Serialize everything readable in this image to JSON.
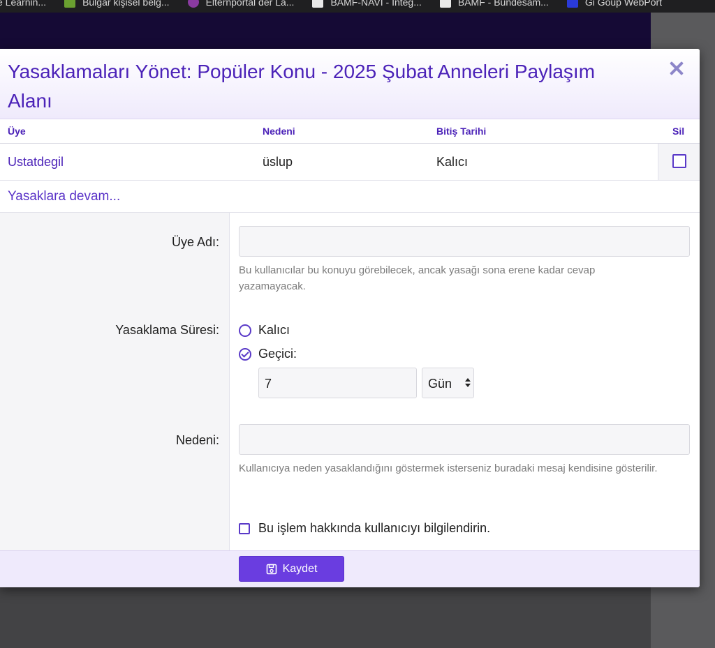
{
  "bookmarks": [
    {
      "label": "e Learnin...",
      "icon": "page-icon",
      "color": "#6a6a6a"
    },
    {
      "label": "Bulgar kişisel belg...",
      "icon": "flag-icon",
      "color": "#6aa030"
    },
    {
      "label": "Elternportal der La...",
      "icon": "star-icon",
      "color": "#8a3aa0"
    },
    {
      "label": "BAMF-NAVI - Integ...",
      "icon": "eagle-icon",
      "color": "#e8e8e8"
    },
    {
      "label": "BAMF - Bundesam...",
      "icon": "eagle-icon",
      "color": "#e8e8e8"
    },
    {
      "label": "Gi Goup WebPort",
      "icon": "logo-icon",
      "color": "#2a3ad8"
    }
  ],
  "modal": {
    "title": "Yasaklamaları Yönet: Popüler Konu - 2025 Şubat Anneleri Paylaşım Alanı",
    "close_icon": "close-icon"
  },
  "table": {
    "headers": {
      "user": "Üye",
      "reason": "Nedeni",
      "end_date": "Bitiş Tarihi",
      "delete": "Sil"
    },
    "rows": [
      {
        "user": "Ustatdegil",
        "reason": "üslup",
        "end_date": "Kalıcı",
        "delete_checked": false
      }
    ],
    "more_link": "Yasaklara devam..."
  },
  "form": {
    "username_label": "Üye Adı:",
    "username_value": "",
    "username_hint": "Bu kullanıcılar bu konuyu görebilecek, ancak yasağı sona erene kadar cevap yazamayacak.",
    "duration_label": "Yasaklama Süresi:",
    "permanent_label": "Kalıcı",
    "temporary_label": "Geçici:",
    "selected_duration": "temporary",
    "duration_value": "7",
    "duration_unit": "Gün",
    "reason_label": "Nedeni:",
    "reason_value": "",
    "reason_hint": "Kullanıcıya neden yasaklandığını göstermek isterseniz buradaki mesaj kendisine gösterilir.",
    "notify_label": "Bu işlem hakkında kullanıcıyı bilgilendirin.",
    "notify_checked": false
  },
  "footer": {
    "save_label": "Kaydet",
    "save_icon": "floppy-disk-icon"
  },
  "colors": {
    "accent": "#4b22b8",
    "button": "#6a3de0",
    "header_bg": "#efeafc"
  }
}
